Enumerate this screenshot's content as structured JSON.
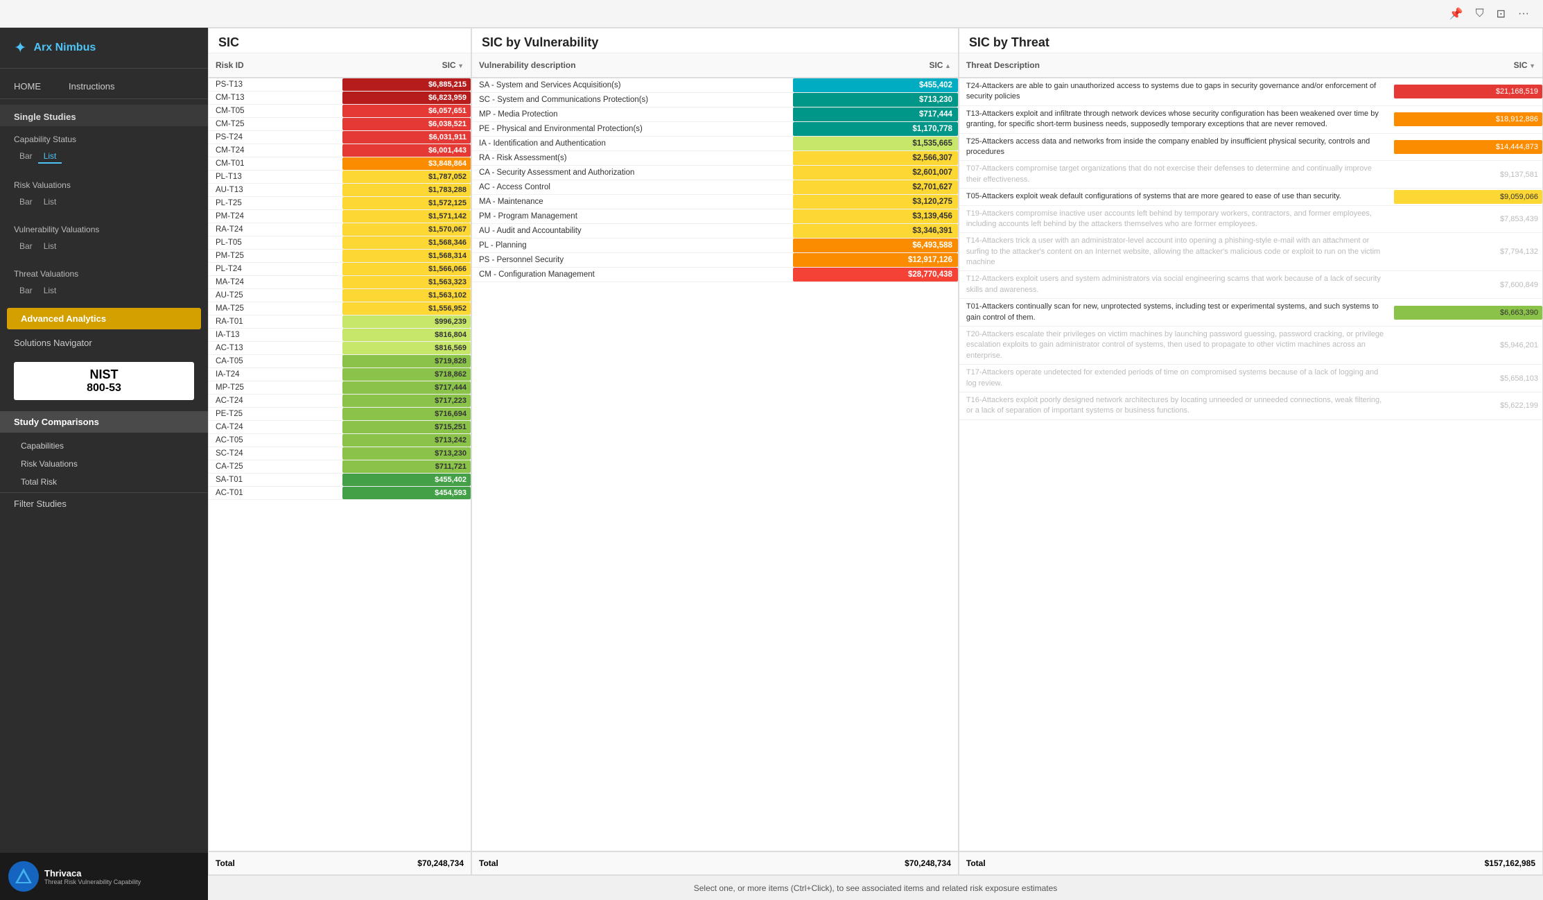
{
  "app": {
    "title": "Arx Nimbus",
    "topbar_icons": [
      "pin-icon",
      "filter-icon",
      "expand-icon",
      "more-icon"
    ]
  },
  "sidebar": {
    "logo": "Arx Nimbus",
    "nav": {
      "home": "HOME",
      "instructions": "Instructions"
    },
    "single_studies": "Single Studies",
    "capability_status": {
      "label": "Capability Status",
      "sub_bar": "Bar",
      "sub_list": "List"
    },
    "risk_valuations": {
      "label": "Risk Valuations",
      "sub_bar": "Bar",
      "sub_list": "List"
    },
    "vulnerability_valuations": {
      "label": "Vulnerability Valuations",
      "sub_bar": "Bar",
      "sub_list": "List"
    },
    "threat_valuations": {
      "label": "Threat Valuations",
      "sub_bar": "Bar",
      "sub_list": "List"
    },
    "advanced_analytics": "Advanced Analytics",
    "solutions_navigator": "Solutions Navigator",
    "nist": {
      "line1": "NIST",
      "line2": "800-53"
    },
    "study_comparisons": "Study Comparisons",
    "study_items": [
      "Capabilities",
      "Risk Valuations",
      "Total Risk"
    ],
    "filter_studies": "Filter Studies",
    "thrivaca": {
      "name": "Thrivaca",
      "subtitle": "Threat Risk Vulnerability Capability"
    }
  },
  "sic_panel": {
    "title": "SIC",
    "columns": {
      "risk_id": "Risk ID",
      "sic": "SIC"
    },
    "sort_col": "sic",
    "sort_dir": "desc",
    "rows": [
      {
        "risk_id": "PS-T13",
        "sic": "$6,885,215",
        "color": "bg-dark-red"
      },
      {
        "risk_id": "CM-T13",
        "sic": "$6,823,959",
        "color": "bg-dark-red"
      },
      {
        "risk_id": "CM-T05",
        "sic": "$6,057,651",
        "color": "bg-red"
      },
      {
        "risk_id": "CM-T25",
        "sic": "$6,038,521",
        "color": "bg-red"
      },
      {
        "risk_id": "PS-T24",
        "sic": "$6,031,911",
        "color": "bg-red"
      },
      {
        "risk_id": "CM-T24",
        "sic": "$6,001,443",
        "color": "bg-red"
      },
      {
        "risk_id": "CM-T01",
        "sic": "$3,848,864",
        "color": "bg-orange"
      },
      {
        "risk_id": "PL-T13",
        "sic": "$1,787,052",
        "color": "bg-yellow"
      },
      {
        "risk_id": "AU-T13",
        "sic": "$1,783,288",
        "color": "bg-yellow"
      },
      {
        "risk_id": "PL-T25",
        "sic": "$1,572,125",
        "color": "bg-yellow"
      },
      {
        "risk_id": "PM-T24",
        "sic": "$1,571,142",
        "color": "bg-yellow"
      },
      {
        "risk_id": "RA-T24",
        "sic": "$1,570,067",
        "color": "bg-yellow"
      },
      {
        "risk_id": "PL-T05",
        "sic": "$1,568,346",
        "color": "bg-yellow"
      },
      {
        "risk_id": "PM-T25",
        "sic": "$1,568,314",
        "color": "bg-yellow"
      },
      {
        "risk_id": "PL-T24",
        "sic": "$1,566,066",
        "color": "bg-yellow"
      },
      {
        "risk_id": "MA-T24",
        "sic": "$1,563,323",
        "color": "bg-yellow"
      },
      {
        "risk_id": "AU-T25",
        "sic": "$1,563,102",
        "color": "bg-yellow"
      },
      {
        "risk_id": "MA-T25",
        "sic": "$1,556,952",
        "color": "bg-yellow"
      },
      {
        "risk_id": "RA-T01",
        "sic": "$996,239",
        "color": "bg-yellow-green"
      },
      {
        "risk_id": "IA-T13",
        "sic": "$816,804",
        "color": "bg-yellow-green"
      },
      {
        "risk_id": "AC-T13",
        "sic": "$816,569",
        "color": "bg-yellow-green"
      },
      {
        "risk_id": "CA-T05",
        "sic": "$719,828",
        "color": "bg-lime"
      },
      {
        "risk_id": "IA-T24",
        "sic": "$718,862",
        "color": "bg-lime"
      },
      {
        "risk_id": "MP-T25",
        "sic": "$717,444",
        "color": "bg-lime"
      },
      {
        "risk_id": "AC-T24",
        "sic": "$717,223",
        "color": "bg-lime"
      },
      {
        "risk_id": "PE-T25",
        "sic": "$716,694",
        "color": "bg-lime"
      },
      {
        "risk_id": "CA-T24",
        "sic": "$715,251",
        "color": "bg-lime"
      },
      {
        "risk_id": "AC-T05",
        "sic": "$713,242",
        "color": "bg-lime"
      },
      {
        "risk_id": "SC-T24",
        "sic": "$713,230",
        "color": "bg-lime"
      },
      {
        "risk_id": "CA-T25",
        "sic": "$711,721",
        "color": "bg-lime"
      },
      {
        "risk_id": "SA-T01",
        "sic": "$455,402",
        "color": "bg-green"
      },
      {
        "risk_id": "AC-T01",
        "sic": "$454,593",
        "color": "bg-green"
      }
    ],
    "total_label": "Total",
    "total_value": "$70,248,734"
  },
  "vuln_panel": {
    "title": "SIC by Vulnerability",
    "columns": {
      "desc": "Vulnerability description",
      "sic": "SIC"
    },
    "sort_col": "sic",
    "sort_dir": "asc",
    "rows": [
      {
        "desc": "SA - System and Services Acquisition(s)",
        "sic": "$455,402",
        "color": "bg-cyan"
      },
      {
        "desc": "SC - System and Communications Protection(s)",
        "sic": "$713,230",
        "color": "bg-teal"
      },
      {
        "desc": "MP - Media Protection",
        "sic": "$717,444",
        "color": "bg-teal"
      },
      {
        "desc": "PE - Physical and Environmental Protection(s)",
        "sic": "$1,170,778",
        "color": "bg-teal"
      },
      {
        "desc": "IA - Identification and Authentication",
        "sic": "$1,535,665",
        "color": "bg-yellow-green"
      },
      {
        "desc": "RA - Risk Assessment(s)",
        "sic": "$2,566,307",
        "color": "bg-yellow"
      },
      {
        "desc": "CA - Security Assessment and Authorization",
        "sic": "$2,601,007",
        "color": "bg-yellow"
      },
      {
        "desc": "AC - Access Control",
        "sic": "$2,701,627",
        "color": "bg-yellow"
      },
      {
        "desc": "MA - Maintenance",
        "sic": "$3,120,275",
        "color": "bg-yellow"
      },
      {
        "desc": "PM - Program Management",
        "sic": "$3,139,456",
        "color": "bg-yellow"
      },
      {
        "desc": "AU - Audit and Accountability",
        "sic": "$3,346,391",
        "color": "bg-yellow"
      },
      {
        "desc": "PL - Planning",
        "sic": "$6,493,588",
        "color": "bg-orange"
      },
      {
        "desc": "PS - Personnel Security",
        "sic": "$12,917,126",
        "color": "bg-orange"
      },
      {
        "desc": "CM - Configuration Management",
        "sic": "$28,770,438",
        "color": "bg-bright-red"
      }
    ],
    "total_label": "Total",
    "total_value": "$70,248,734"
  },
  "threat_panel": {
    "title": "SIC by Threat",
    "columns": {
      "threat_desc": "Threat Description",
      "sic": "SIC"
    },
    "rows": [
      {
        "desc": "T24-Attackers are able to gain unauthorized access to systems due to gaps in security governance and/or enforcement of security policies",
        "sic": "$21,168,519",
        "color": "bg-red",
        "dimmed": false
      },
      {
        "desc": "T13-Attackers exploit and infiltrate through network devices whose security configuration has been weakened over time by granting, for specific short-term business needs, supposedly temporary exceptions that are never removed.",
        "sic": "$18,912,886",
        "color": "bg-orange",
        "dimmed": false
      },
      {
        "desc": "T25-Attackers access data and networks from inside the company enabled by insufficient physical security, controls and procedures",
        "sic": "$14,444,873",
        "color": "bg-orange",
        "dimmed": false
      },
      {
        "desc": "T07-Attackers compromise target organizations that do not exercise their defenses to determine and continually improve their effectiveness.",
        "sic": "$9,137,581",
        "color": "",
        "dimmed": true
      },
      {
        "desc": "T05-Attackers exploit weak default configurations of systems that are more geared to ease of use than security.",
        "sic": "$9,059,066",
        "color": "bg-yellow",
        "dimmed": false
      },
      {
        "desc": "T19-Attackers compromise inactive user accounts left behind by temporary workers, contractors, and former employees, including accounts left behind by the attackers themselves who are former employees.",
        "sic": "$7,853,439",
        "color": "",
        "dimmed": true
      },
      {
        "desc": "T14-Attackers trick a user with an administrator-level account into opening a phishing-style e-mail with an attachment or surfing to the attacker's content on an Internet website, allowing the attacker's malicious code or exploit to run on the victim machine",
        "sic": "$7,794,132",
        "color": "",
        "dimmed": true
      },
      {
        "desc": "T12-Attackers exploit users and system administrators via social engineering scams that work because of a lack of security skills and awareness.",
        "sic": "$7,600,849",
        "color": "",
        "dimmed": true
      },
      {
        "desc": "T01-Attackers continually scan for new, unprotected systems, including test or experimental systems, and such systems to gain control of them.",
        "sic": "$6,663,390",
        "color": "bg-lime",
        "dimmed": false
      },
      {
        "desc": "T20-Attackers escalate their privileges on victim machines by launching password guessing, password cracking, or privilege escalation exploits to gain administrator control of systems, then used to propagate to other victim machines across an enterprise.",
        "sic": "$5,946,201",
        "color": "",
        "dimmed": true
      },
      {
        "desc": "T17-Attackers operate undetected for extended periods of time on compromised systems because of a lack of logging and log review.",
        "sic": "$5,658,103",
        "color": "",
        "dimmed": true
      },
      {
        "desc": "T16-Attackers exploit poorly designed network architectures by locating unneeded or unneeded connections, weak filtering, or a lack of separation of important systems or business functions.",
        "sic": "$5,622,199",
        "color": "",
        "dimmed": true
      }
    ],
    "total_label": "Total",
    "total_value": "$157,162,985"
  },
  "status_bar": {
    "message": "Select one, or more items (Ctrl+Click), to see associated items and related risk exposure estimates"
  }
}
